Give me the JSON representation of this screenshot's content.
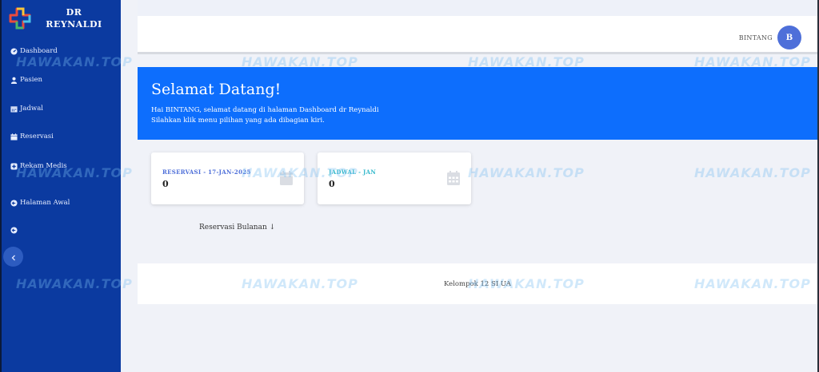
{
  "brand": {
    "line1": "DR",
    "line2": "REYNALDI"
  },
  "sidebar": {
    "items": [
      {
        "label": "Dashboard",
        "icon": "dashboard-icon"
      },
      {
        "label": "Pasien",
        "icon": "user-icon"
      },
      {
        "label": "Jadwal",
        "icon": "calendar-icon"
      },
      {
        "label": "Reservasi",
        "icon": "calendar-check-icon"
      },
      {
        "label": "Rekam Medis",
        "icon": "medical-record-icon"
      },
      {
        "label": "Halaman Awal",
        "icon": "arrow-left-circle-icon"
      },
      {
        "label": "",
        "icon": "logout-icon"
      }
    ]
  },
  "topbar": {
    "user_name": "BINTANG",
    "avatar_initial": "B"
  },
  "hero": {
    "title": "Selamat Datang!",
    "line1": "Hai BINTANG, selamat datang di halaman Dashboard dr Reynaldi",
    "line2": "Silahkan klik menu pilihan yang ada dibagian kiri."
  },
  "cards": [
    {
      "label": "RESERVASI - 17-JAN-2025",
      "value": "0",
      "accent": "#4e6fd9"
    },
    {
      "label": "JADWAL - JAN",
      "value": "0",
      "accent": "#36b9cc"
    }
  ],
  "dropdown": {
    "label": "Reservasi Bulanan ↓"
  },
  "footer": {
    "text": "Kelompok 12 SI UA"
  },
  "watermark": "HAWAKAN.TOP",
  "colors": {
    "sidebar": "#0b3aa0",
    "hero": "#0d6efd",
    "avatar": "#4e6fd9"
  }
}
